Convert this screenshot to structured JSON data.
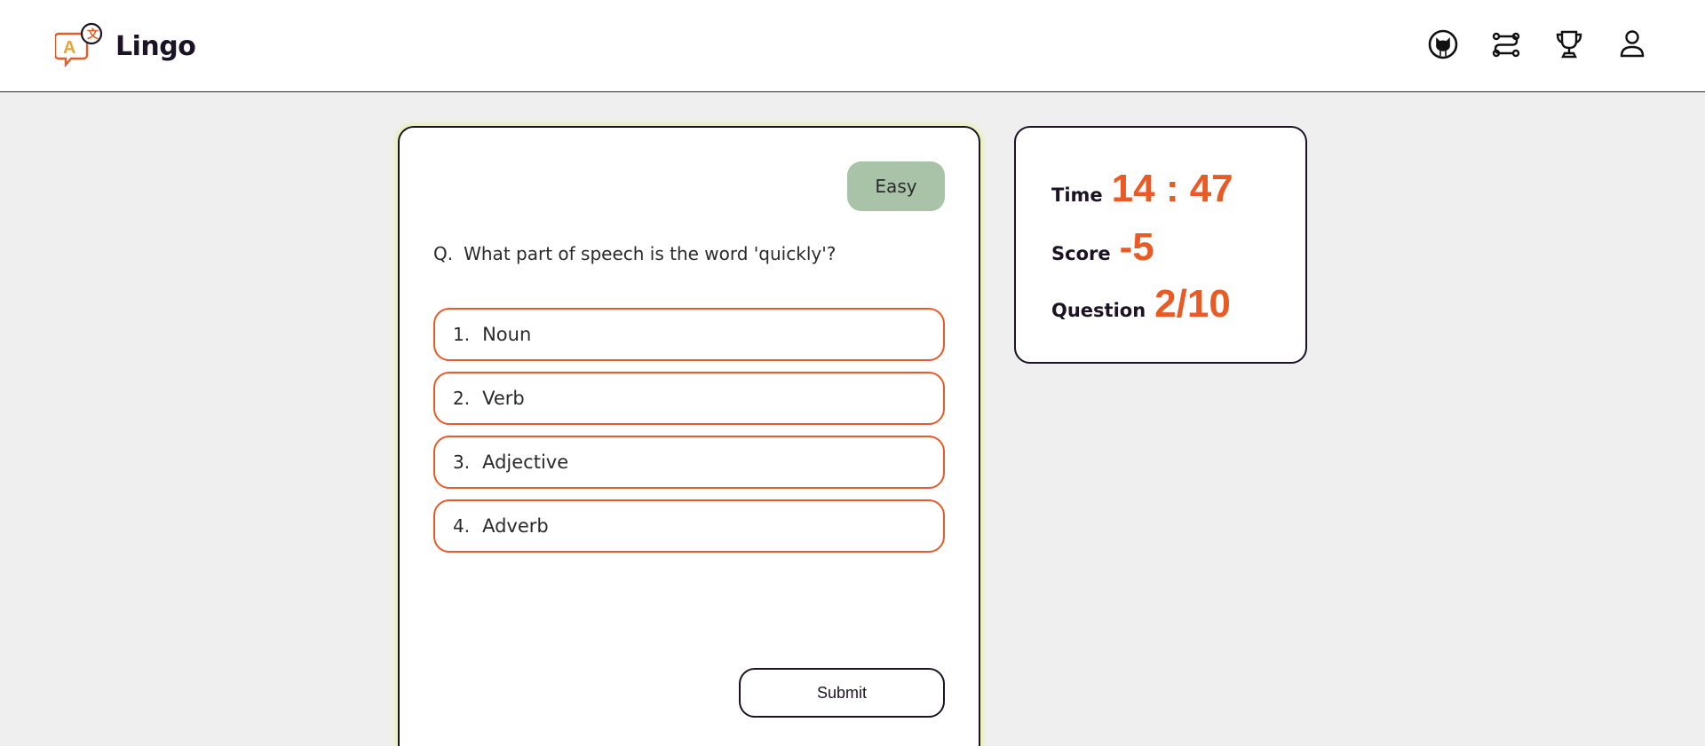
{
  "header": {
    "brand_name": "Lingo",
    "nav": [
      {
        "name": "github-icon"
      },
      {
        "name": "route-icon"
      },
      {
        "name": "trophy-icon"
      },
      {
        "name": "user-icon"
      }
    ]
  },
  "quiz": {
    "difficulty": "Easy",
    "question_prefix": "Q.",
    "question_text": "What part of speech is the word 'quickly'?",
    "options": [
      {
        "number": "1.",
        "label": "Noun"
      },
      {
        "number": "2.",
        "label": "Verb"
      },
      {
        "number": "3.",
        "label": "Adjective"
      },
      {
        "number": "4.",
        "label": "Adverb"
      }
    ],
    "submit_label": "Submit"
  },
  "stats": {
    "time_label": "Time",
    "time_value": "14 : 47",
    "score_label": "Score",
    "score_value": "-5",
    "question_label": "Question",
    "question_value": "2/10"
  },
  "colors": {
    "accent": "#ea5a24",
    "difficulty_bg": "#a9c3a8",
    "text_dark": "#1c1326",
    "glow": "#e4f39a"
  }
}
